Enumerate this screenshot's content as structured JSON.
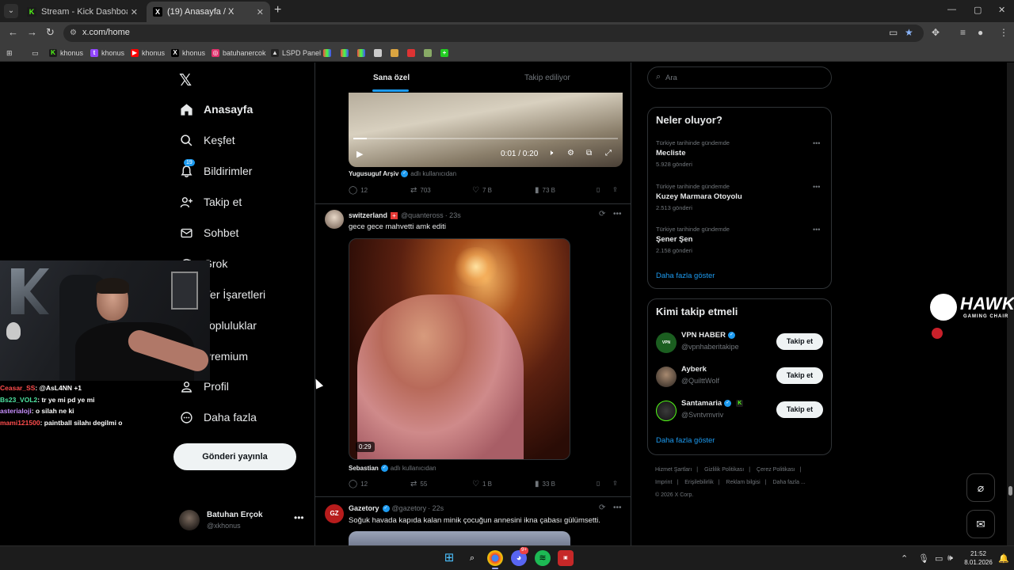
{
  "browser": {
    "tabs": [
      {
        "title": "Stream - Kick Dashboard",
        "favicon": "kick-icon",
        "active": false
      },
      {
        "title": "(19) Anasayfa / X",
        "favicon": "x-icon",
        "active": true
      }
    ],
    "url": "x.com/home",
    "bookmarks": [
      "khonus",
      "khonus",
      "khonus",
      "khonus",
      "batuhanercok",
      "LSPD Panel"
    ]
  },
  "sidebar": {
    "items": [
      {
        "label": "Anasayfa",
        "icon": "home-icon"
      },
      {
        "label": "Keşfet",
        "icon": "search-icon"
      },
      {
        "label": "Bildirimler",
        "icon": "bell-icon",
        "badge": "19"
      },
      {
        "label": "Takip et",
        "icon": "add-person-icon"
      },
      {
        "label": "Sohbet",
        "icon": "envelope-icon"
      },
      {
        "label": "Grok",
        "icon": "grok-icon"
      },
      {
        "label": "Yer İşaretleri",
        "icon": "bookmark-icon"
      },
      {
        "label": "Topluluklar",
        "icon": "communities-icon"
      },
      {
        "label": "Premium",
        "icon": "premium-icon"
      },
      {
        "label": "Profil",
        "icon": "person-icon"
      },
      {
        "label": "Daha fazla",
        "icon": "more-circle-icon"
      }
    ],
    "post_button": "Gönderi yayınla",
    "account": {
      "name": "Batuhan Erçok",
      "handle": "@xkhonus"
    }
  },
  "timeline": {
    "tabs": [
      "Sana özel",
      "Takip ediliyor"
    ],
    "post1": {
      "video_time": "0:01 / 0:20",
      "video_progress": 0.05,
      "attribution_name": "Yugusuguf Arşiv",
      "attribution_suffix": "adlı kullanıcıdan",
      "replies": "12",
      "reposts": "703",
      "likes": "7 B",
      "views": "73 B"
    },
    "post2": {
      "name": "switzerland",
      "handle": "@quanteross",
      "time": "· 23s",
      "text": "gece gece mahvetti amk editi",
      "video_duration": "0:29",
      "attribution_name": "Sebastian",
      "attribution_suffix": "adlı kullanıcıdan",
      "replies": "12",
      "reposts": "55",
      "likes": "1 B",
      "views": "33 B"
    },
    "post3": {
      "name": "Gazetory",
      "handle": "@gazetory",
      "time": "· 22s",
      "text": "Soğuk havada kapıda kalan minik çocuğun annesini ikna çabası gülümsetti."
    }
  },
  "right": {
    "search_placeholder": "Ara",
    "trends_title": "Neler oluyor?",
    "trends": [
      {
        "context": "Türkiye tarihinde gündemde",
        "name": "Mecliste",
        "count": "5.928 gönderi"
      },
      {
        "context": "Türkiye tarihinde gündemde",
        "name": "Kuzey Marmara Otoyolu",
        "count": "2.513 gönderi"
      },
      {
        "context": "Türkiye tarihinde gündemde",
        "name": "Şener Şen",
        "count": "2.158 gönderi"
      }
    ],
    "show_more": "Daha fazla göster",
    "who_title": "Kimi takip etmeli",
    "who": [
      {
        "name": "VPN HABER",
        "handle": "@vpnhaberitakipe",
        "verified": true
      },
      {
        "name": "Ayberk",
        "handle": "@QuilttWolf",
        "verified": false
      },
      {
        "name": "Santamaria",
        "handle": "@Svntvmvriv",
        "verified": true
      }
    ],
    "follow_label": "Takip et",
    "who_show_more": "Daha fazla göster",
    "footer": [
      "Hizmet Şartları",
      "Gizlilik Politikası",
      "Çerez Politikası",
      "Imprint",
      "Erişilebilirlik",
      "Reklam bilgisi",
      "Daha fazla ...",
      "© 2026 X Corp."
    ]
  },
  "overlay": {
    "brand_word": "HAWK",
    "brand_sub": "GAMING CHAIR",
    "chat": [
      {
        "user": "Ceasar_SS",
        "msg": ": @AsL4NN +1",
        "color": "#ff4d4d"
      },
      {
        "user": "Bs23_VOL2",
        "msg": ": tr ye mi pd ye mi",
        "color": "#4de3a0"
      },
      {
        "user": "asterialoji",
        "msg": ": o silah ne ki",
        "color": "#c890ff"
      },
      {
        "user": "mami121500",
        "msg": ": paintball silahı degilmi o",
        "color": "#ff4d4d"
      }
    ]
  },
  "taskbar": {
    "time": "21:52",
    "date": "8.01.2026",
    "discord_badge": "9+"
  },
  "colors": {
    "accent": "#1d9bf0",
    "kick": "#53fc18",
    "background": "#000000"
  }
}
